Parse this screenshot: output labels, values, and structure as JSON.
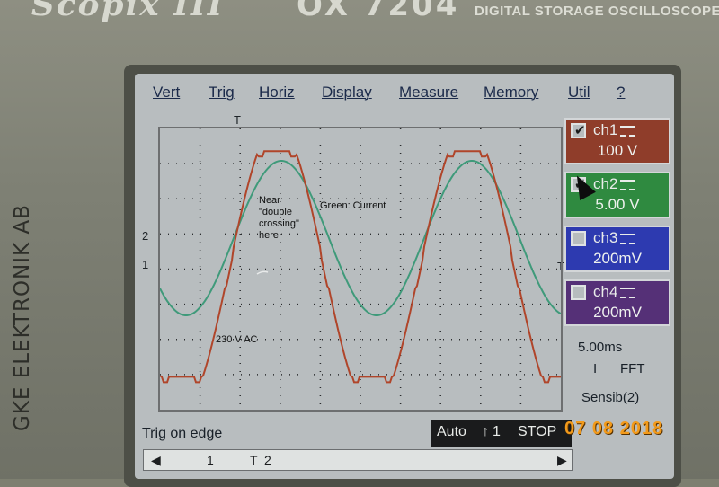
{
  "device": {
    "brand": "Scopix III",
    "model": "OX 7204",
    "subtitle": "DIGITAL STORAGE OSCILLOSCOPE",
    "vendor": "GKE ELEKTRONIK AB"
  },
  "menu": [
    "Vert",
    "Trig",
    "Horiz",
    "Display",
    "Measure",
    "Memory",
    "Util",
    "?"
  ],
  "channels": [
    {
      "name": "ch1",
      "value": "100 V",
      "checked": true,
      "color": "#8f3d2a"
    },
    {
      "name": "ch2",
      "value": "5.00 V",
      "checked": true,
      "color": "#2f8a40"
    },
    {
      "name": "ch3",
      "value": "200mV",
      "checked": false,
      "color": "#2d3ab0"
    },
    {
      "name": "ch4",
      "value": "200mV",
      "checked": false,
      "color": "#553077"
    }
  ],
  "horizontal": {
    "timebase": "5.00ms",
    "fft_label": "FFT",
    "fft_prefix": "I",
    "sensib": "Sensib(2)"
  },
  "trigger": {
    "mode_text": "Trig on edge",
    "mode": "Auto",
    "source": "1",
    "state": "STOP"
  },
  "markers": {
    "trigger_top": "T",
    "trigger_right": "T",
    "ch1_level": "1",
    "ch2_level": "2"
  },
  "scrollbar": {
    "left": "◀",
    "right": "▶",
    "mark1": "1",
    "markT": "T",
    "mark2": "2"
  },
  "annotations": {
    "near_crossing": "Near\n\"double\ncrossing\"\nhere",
    "green": "Green: Current",
    "red": "230 V AC"
  },
  "datestamp": "07 08 2018",
  "colors": {
    "voltage_trace": "#b0452a",
    "current_trace": "#3f9a7a",
    "grid": "#2a2c2e",
    "screen_bg": "#b8bdbf"
  }
}
